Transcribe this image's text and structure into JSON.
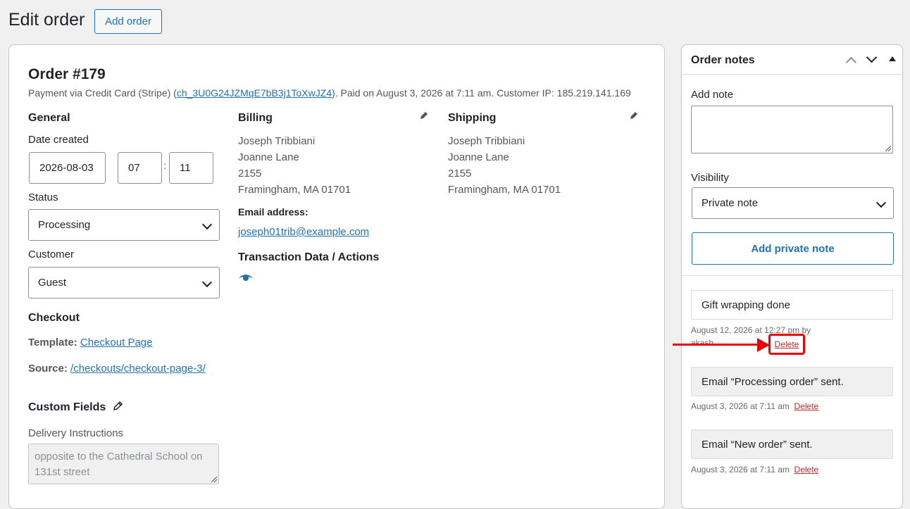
{
  "page": {
    "title": "Edit order",
    "add_order_label": "Add order"
  },
  "order": {
    "heading": "Order #179",
    "payment_prefix": "Payment via Credit Card (Stripe) (",
    "transaction_id": "ch_3U0G24JZMqE7bB3j1ToXwJZ4",
    "payment_suffix": "). Paid on August 3, 2026 at 7:11 am. Customer IP: 185.219.141.169"
  },
  "general": {
    "heading": "General",
    "date_created_label": "Date created",
    "date_value": "2026-08-03",
    "hour_value": "07",
    "time_separator": ":",
    "minute_value": "11",
    "status_label": "Status",
    "status_value": "Processing",
    "customer_label": "Customer",
    "customer_value": "Guest"
  },
  "checkout": {
    "heading": "Checkout",
    "template_label": "Template:",
    "template_link": "Checkout Page",
    "source_label": "Source:",
    "source_link": "/checkouts/checkout-page-3/"
  },
  "custom_fields": {
    "heading": "Custom Fields",
    "delivery_label": "Delivery Instructions",
    "delivery_value": "opposite to the Cathedral School on 131st street"
  },
  "billing": {
    "heading": "Billing",
    "lines": [
      "Joseph Tribbiani",
      "Joanne Lane",
      "2155",
      "Framingham, MA 01701"
    ],
    "email_label": "Email address:",
    "email": "joseph01trib@example.com",
    "transaction_heading": "Transaction Data / Actions"
  },
  "shipping": {
    "heading": "Shipping",
    "lines": [
      "Joseph Tribbiani",
      "Joanne Lane",
      "2155",
      "Framingham, MA 01701"
    ]
  },
  "order_notes": {
    "title": "Order notes",
    "add_note_label": "Add note",
    "visibility_label": "Visibility",
    "visibility_value": "Private note",
    "add_button_label": "Add private note",
    "delete_label": "Delete",
    "notes": [
      {
        "text": "Gift wrapping done",
        "meta_line1": "August 12, 2026 at 12:27 pm by",
        "meta_line2": "akash"
      },
      {
        "text": "Email “Processing order” sent.",
        "meta": "August 3, 2026 at 7:11 am"
      },
      {
        "text": "Email “New order” sent.",
        "meta": "August 3, 2026 at 7:11 am"
      }
    ]
  },
  "colors": {
    "accent": "#2271b1",
    "delete": "#b32d2e",
    "annotation": "#ee0000"
  },
  "icons": [
    "pencil-icon",
    "eye-icon",
    "chevron-down-icon",
    "chevron-up-icon",
    "triangle-up-icon",
    "arrow-annotation"
  ]
}
